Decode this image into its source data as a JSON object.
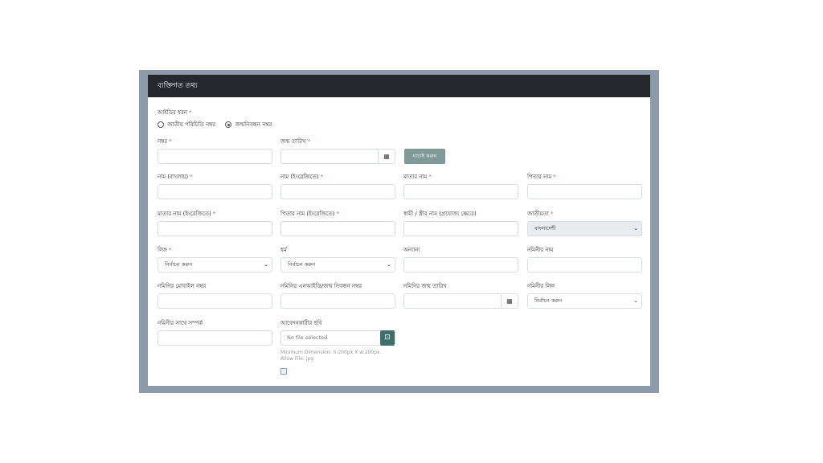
{
  "panel": {
    "title": "ব্যক্তিগত তথ্য"
  },
  "id_type": {
    "label": "আইডির ধরন",
    "options": [
      "জাতীয় পরিচিতি নম্বর",
      "জন্মনিবন্ধন নম্বর"
    ],
    "selected": "জন্মনিবন্ধন নম্বর"
  },
  "row1": {
    "number_label": "নম্বর",
    "dob_label": "জন্ম তারিখ",
    "verify_button": "যাচাই করুন"
  },
  "row2": {
    "name_bn": "নাম (বাংলায়)",
    "name_en": "নাম (ইংরেজিতে)",
    "mother_name": "মাতার নাম",
    "father_name": "পিতার নাম"
  },
  "row3": {
    "mother_name_en": "মাতার নাম (ইংরেজিতে)",
    "father_name_en": "পিতার নাম (ইংরেজিতে)",
    "spouse_name": "স্বামী / স্ত্রীর নাম (প্রযোজ্য ক্ষেত্রে)",
    "nationality": "জাতীয়তা",
    "nationality_value": "বাংলাদেশী"
  },
  "row4": {
    "gender": "লিঙ্গ",
    "gender_value": "নির্বাচন করুন",
    "religion": "ধর্ম",
    "religion_value": "নির্বাচন করুন",
    "other": "অন্যান্য",
    "nominee_name": "নমিনীর নাম"
  },
  "row5": {
    "nominee_mobile": "নমিনির মোবাইল নম্বর",
    "nominee_nid": "নমিনির এনআইডি/জন্ম নিবন্ধন নম্বর",
    "nominee_dob": "নমিনির জন্ম তারিখ",
    "nominee_gender": "নমিনীর লিঙ্গ",
    "nominee_gender_value": "নির্বাচন করুন"
  },
  "row6": {
    "nominee_relation": "নমিনীর সাথে সম্পর্ক",
    "applicant_photo": "আবেদনকারীর ছবি",
    "file_placeholder": "No file selected",
    "hint_line1": "Minimum Dimension: h:200px X w:200px.",
    "hint_line2": "Allow File: jpg"
  },
  "colors": {
    "header_bg": "#25292e",
    "frame": "#8d9aa9",
    "required": "#d9534f",
    "verify_btn": "#7f9a98",
    "file_btn": "#3f6f6a"
  },
  "icons": [
    "calendar-icon",
    "chevron-down-icon",
    "file-upload-icon",
    "broken-image-icon"
  ]
}
